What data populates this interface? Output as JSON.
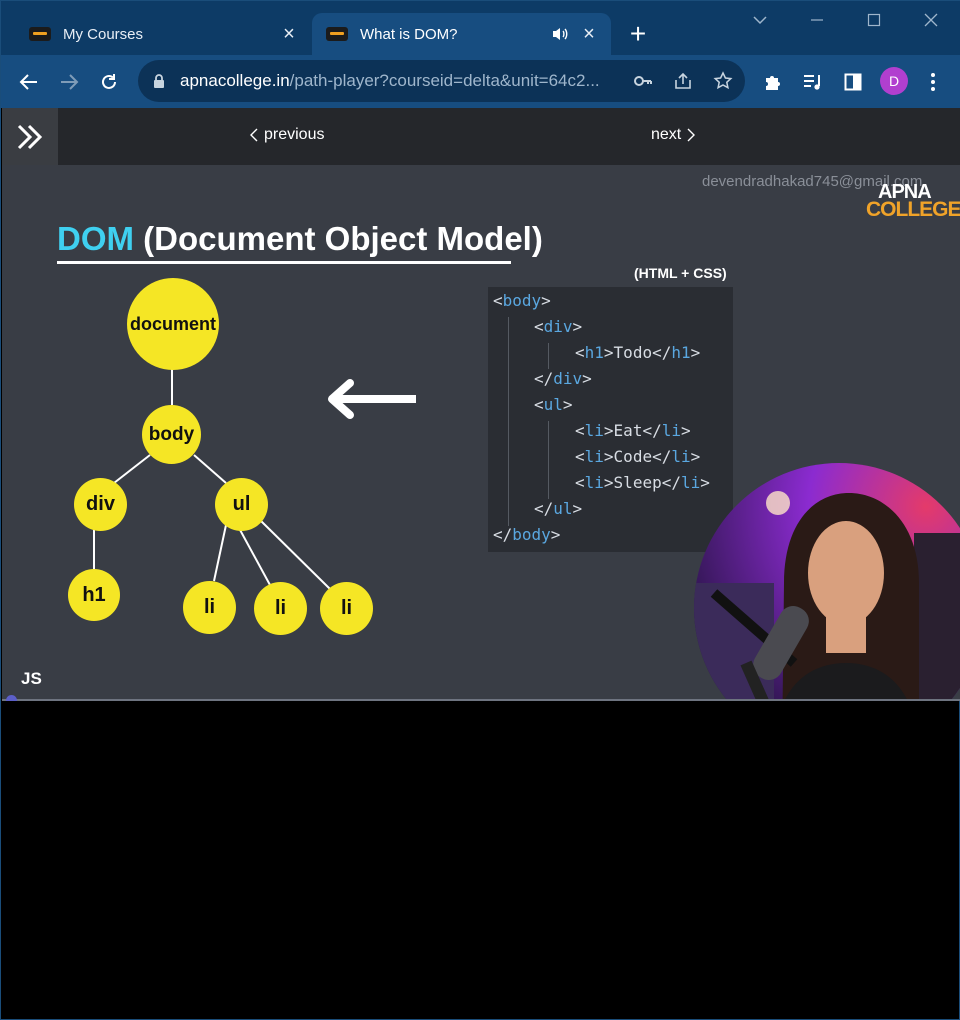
{
  "browser": {
    "tabs": [
      {
        "title": "My Courses",
        "active": false
      },
      {
        "title": "What is DOM?",
        "active": true
      }
    ],
    "address": {
      "host": "apnacollege.in",
      "path": "/path-player?courseid=delta&unit=64c2..."
    },
    "profile_initial": "D"
  },
  "player": {
    "previous_label": "previous",
    "next_label": "next",
    "sidebar_toggle_icon": "double-chevron-right-icon"
  },
  "slide": {
    "watermark_email": "devendradhakad745@gmail.com",
    "brand_top": "APNA",
    "brand_bottom": "COLLEGE",
    "title_dom": "DOM",
    "title_rest": " (Document Object Model)",
    "code_caption": "(HTML + CSS)",
    "tree_nodes": {
      "document": "document",
      "body": "body",
      "div": "div",
      "ul": "ul",
      "h1": "h1",
      "li1": "li",
      "li2": "li",
      "li3": "li"
    },
    "code_lines": [
      {
        "open": "<",
        "tag": "body",
        "close": ">",
        "text": ""
      },
      {
        "open": "<",
        "tag": "div",
        "close": ">",
        "text": ""
      },
      {
        "open": "<",
        "tag": "h1",
        "close": ">",
        "text": "Todo",
        "end": "h1"
      },
      {
        "open": "</",
        "tag": "div",
        "close": ">",
        "text": ""
      },
      {
        "open": "<",
        "tag": "ul",
        "close": ">",
        "text": ""
      },
      {
        "open": "<",
        "tag": "li",
        "close": ">",
        "text": "Eat",
        "end": "li"
      },
      {
        "open": "<",
        "tag": "li",
        "close": ">",
        "text": "Code",
        "end": "li"
      },
      {
        "open": "<",
        "tag": "li",
        "close": ">",
        "text": "Sleep",
        "end": "li"
      },
      {
        "open": "</",
        "tag": "ul",
        "close": ">",
        "text": ""
      },
      {
        "open": "</",
        "tag": "body",
        "close": ">",
        "text": ""
      }
    ],
    "chapter_label": "JS"
  },
  "colors": {
    "node_yellow": "#f5e625",
    "dom_cyan": "#3fd0f0",
    "tag_blue": "#5aa7e0",
    "brand_orange": "#f0a329"
  }
}
